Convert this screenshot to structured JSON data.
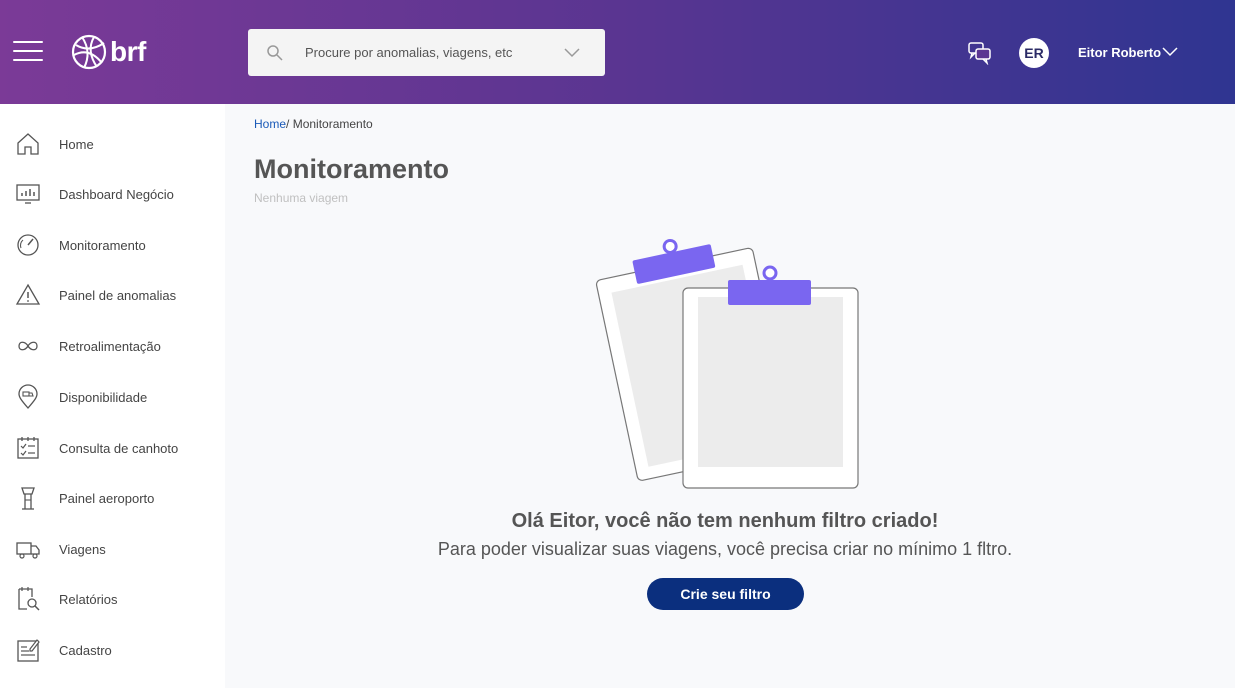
{
  "header": {
    "logo_text": "brf",
    "search": {
      "placeholder": "Procure por anomalias, viagens, etc"
    },
    "user": {
      "initials": "ER",
      "name": "Eitor Roberto"
    }
  },
  "sidebar": {
    "items": [
      {
        "label": "Home",
        "icon": "home-icon"
      },
      {
        "label": "Dashboard Negócio",
        "icon": "dashboard-icon"
      },
      {
        "label": "Monitoramento",
        "icon": "gauge-icon"
      },
      {
        "label": "Painel de anomalias",
        "icon": "warning-icon"
      },
      {
        "label": "Retroalimentação",
        "icon": "infinity-icon"
      },
      {
        "label": "Disponibilidade",
        "icon": "location-truck-icon"
      },
      {
        "label": "Consulta de canhoto",
        "icon": "checklist-icon"
      },
      {
        "label": "Painel aeroporto",
        "icon": "control-tower-icon"
      },
      {
        "label": "Viagens",
        "icon": "truck-icon"
      },
      {
        "label": "Relatórios",
        "icon": "report-search-icon"
      },
      {
        "label": "Cadastro",
        "icon": "form-edit-icon"
      }
    ]
  },
  "main": {
    "breadcrumb": {
      "home": "Home",
      "separator": "/",
      "current": " Monitoramento"
    },
    "title": "Monitoramento",
    "subtitle": "Nenhuma viagem",
    "empty_state": {
      "title": "Olá Eitor, você não tem nenhum filtro criado!",
      "text": "Para poder visualizar suas viagens, você precisa criar no mínimo 1 fltro.",
      "button": "Crie seu filtro"
    }
  },
  "colors": {
    "header_gradient_start": "#7b3a97",
    "header_gradient_end": "#2f3591",
    "cta": "#0b2f7e",
    "clip": "#7a66f0",
    "link": "#1a5ab8"
  }
}
